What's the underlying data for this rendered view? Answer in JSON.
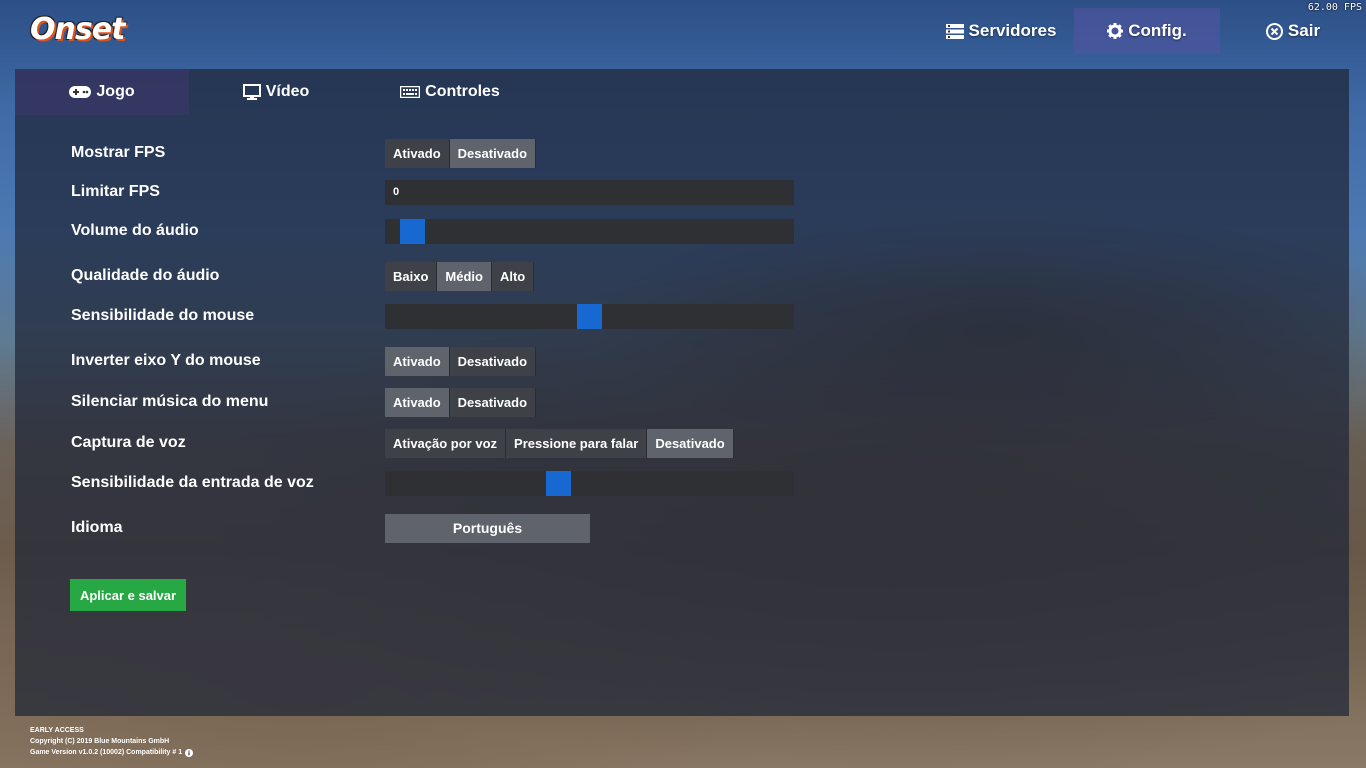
{
  "fps_counter": "62.00 FPS",
  "logo": "Onset",
  "nav": [
    {
      "label": "Servidores",
      "icon": "server-icon"
    },
    {
      "label": "Config.",
      "icon": "gear-icon"
    },
    {
      "label": "Sair",
      "icon": "close-circle-icon"
    }
  ],
  "tabs": [
    {
      "label": "Jogo",
      "icon": "gamepad-icon"
    },
    {
      "label": "Vídeo",
      "icon": "monitor-icon"
    },
    {
      "label": "Controles",
      "icon": "keyboard-icon"
    }
  ],
  "settings": {
    "show_fps": {
      "label": "Mostrar FPS",
      "options": [
        "Ativado",
        "Desativado"
      ],
      "selected": "Desativado"
    },
    "limit_fps": {
      "label": "Limitar FPS",
      "value": "0"
    },
    "audio_volume": {
      "label": "Volume do áudio",
      "level": 0.04
    },
    "audio_quality": {
      "label": "Qualidade do áudio",
      "options": [
        "Baixo",
        "Médio",
        "Alto"
      ],
      "selected": "Médio"
    },
    "mouse_sensitivity": {
      "label": "Sensibilidade do mouse",
      "level": 0.5
    },
    "invert_mouse_y": {
      "label": "Inverter eixo Y do mouse",
      "options": [
        "Ativado",
        "Desativado"
      ],
      "selected": "Ativado"
    },
    "mute_menu_music": {
      "label": "Silenciar música do menu",
      "options": [
        "Ativado",
        "Desativado"
      ],
      "selected": "Ativado"
    },
    "voice_capture": {
      "label": "Captura de voz",
      "options": [
        "Ativação por voz",
        "Pressione para falar",
        "Desativado"
      ],
      "selected": "Desativado"
    },
    "voice_input_sensitivity": {
      "label": "Sensibilidade da entrada de voz",
      "level": 0.42
    },
    "language": {
      "label": "Idioma",
      "value": "Português"
    }
  },
  "apply_button": "Aplicar e salvar",
  "footer": {
    "line1": "EARLY ACCESS",
    "line2": "Copyright (C) 2019 Blue Mountains GmbH",
    "line3": "Game Version v1.0.2 (10002) Compatibility # 1"
  },
  "colors": {
    "accent": "#1769d1",
    "apply": "#28a745",
    "active_nav": "#50559f"
  }
}
